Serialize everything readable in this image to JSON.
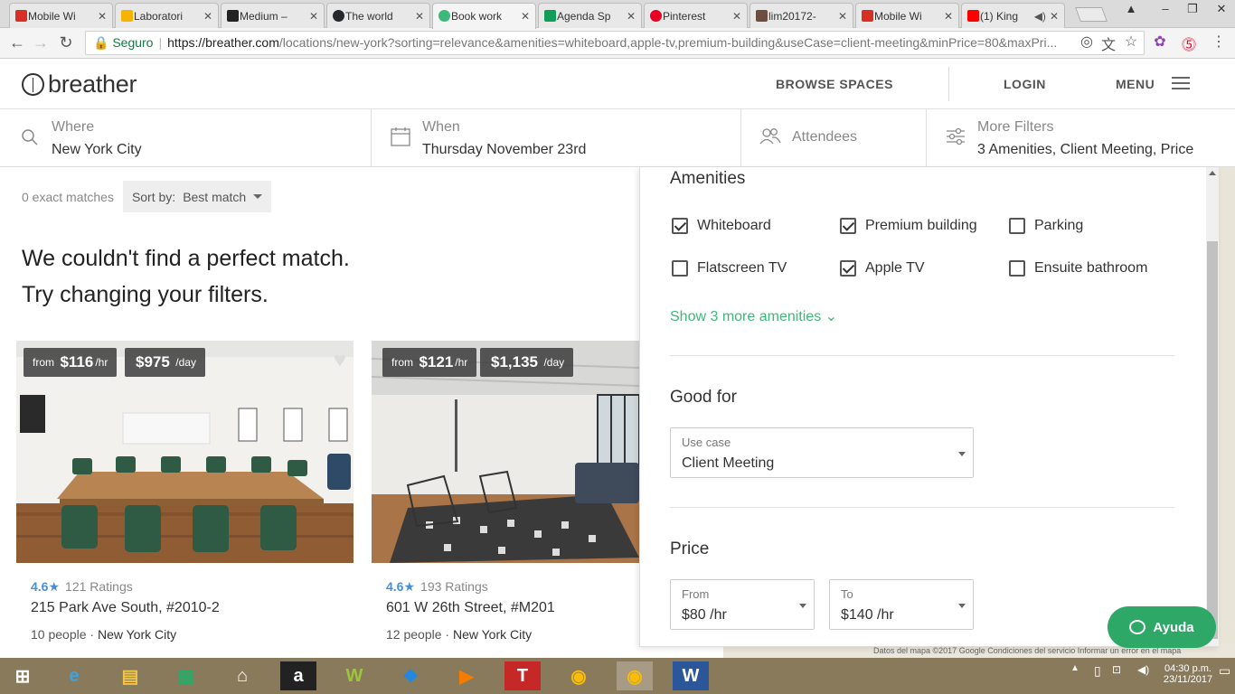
{
  "browser": {
    "tabs": [
      {
        "title": "Mobile Wi",
        "color": "#d93025"
      },
      {
        "title": "Laboratori",
        "color": "#f4b400"
      },
      {
        "title": "Medium –",
        "color": "#222222"
      },
      {
        "title": "The world",
        "color": "#24292e"
      },
      {
        "title": "Book work",
        "color": "#3cb878"
      },
      {
        "title": "Agenda Sp",
        "color": "#0f9d58"
      },
      {
        "title": "Pinterest",
        "color": "#e60023"
      },
      {
        "title": "lim20172-",
        "color": "#6d4c41"
      },
      {
        "title": "Mobile Wi",
        "color": "#d93025"
      },
      {
        "title": "(1) King",
        "color": "#ff0000"
      }
    ],
    "active_tab_index": 4,
    "secure_label": "Seguro",
    "url_domain": "https://breather.com",
    "url_path": "/locations/new-york?sorting=relevance&amenities=whiteboard,apple-tv,premium-building&useCase=client-meeting&minPrice=80&maxPri..."
  },
  "header": {
    "logo_text": "breather",
    "browse": "BROWSE SPACES",
    "login": "LOGIN",
    "menu": "MENU"
  },
  "search": {
    "where_label": "Where",
    "where_value": "New York City",
    "when_label": "When",
    "when_value": "Thursday November 23rd",
    "attendees_label": "Attendees",
    "filters_label": "More Filters",
    "filters_value": "3 Amenities, Client Meeting, Price"
  },
  "results": {
    "matches": "0 exact matches",
    "sort_label": "Sort by:",
    "sort_value": "Best match",
    "nomatch_line1": "We couldn't find a perfect match.",
    "nomatch_line2": "Try changing your filters."
  },
  "cards": [
    {
      "from": "from",
      "hourly": "$116",
      "hr": "/hr",
      "daily": "$975",
      "day": "/day",
      "rating": "4.6",
      "ratings_count": "121 Ratings",
      "address": "215 Park Ave South, #2010-2",
      "people": "10 people",
      "city": "New York City"
    },
    {
      "from": "from",
      "hourly": "$121",
      "hr": "/hr",
      "daily": "$1,135",
      "day": "/day",
      "rating": "4.6",
      "ratings_count": "193 Ratings",
      "address": "601 W 26th Street, #M201",
      "people": "12 people",
      "city": "New York City"
    }
  ],
  "filters": {
    "amenities_title": "Amenities",
    "amenities": [
      {
        "label": "Whiteboard",
        "checked": true
      },
      {
        "label": "Premium building",
        "checked": true
      },
      {
        "label": "Parking",
        "checked": false
      },
      {
        "label": "Flatscreen TV",
        "checked": false
      },
      {
        "label": "Apple TV",
        "checked": true
      },
      {
        "label": "Ensuite bathroom",
        "checked": false
      }
    ],
    "show_more": "Show 3 more amenities",
    "good_for_title": "Good for",
    "use_case_label": "Use case",
    "use_case_value": "Client Meeting",
    "price_title": "Price",
    "from_label": "From",
    "from_value": "$80 /hr",
    "to_label": "To",
    "to_value": "$140 /hr"
  },
  "map_footer": "Datos del mapa ©2017 Google   Condiciones del servicio   Informar un error en el mapa",
  "help_label": "Ayuda",
  "taskbar": {
    "time": "04:30 p.m.",
    "date": "23/11/2017"
  },
  "colors": {
    "brand_green": "#3cb878",
    "rating_blue": "#4a8fd6",
    "help_green": "#2ea866"
  }
}
